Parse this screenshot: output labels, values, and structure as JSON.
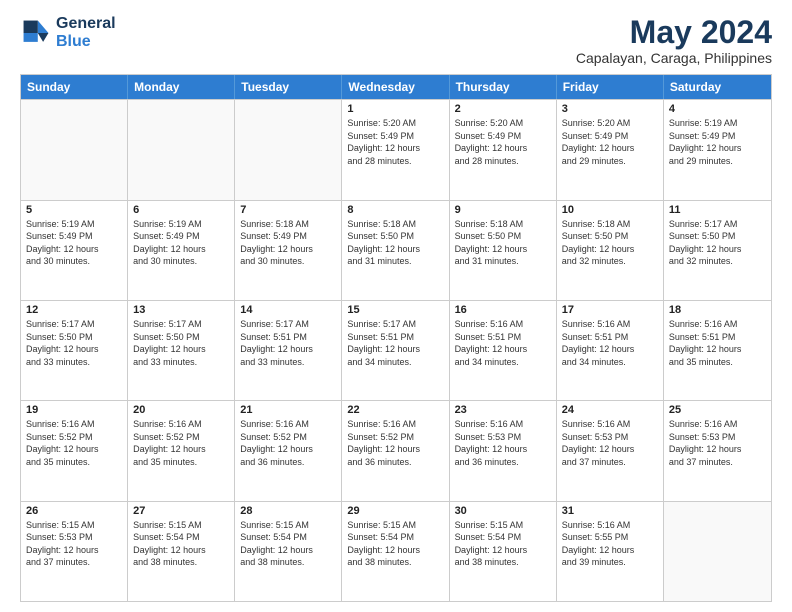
{
  "logo": {
    "line1": "General",
    "line2": "Blue"
  },
  "title": "May 2024",
  "subtitle": "Capalayan, Caraga, Philippines",
  "header_days": [
    "Sunday",
    "Monday",
    "Tuesday",
    "Wednesday",
    "Thursday",
    "Friday",
    "Saturday"
  ],
  "weeks": [
    [
      {
        "day": "",
        "info": "",
        "empty": true
      },
      {
        "day": "",
        "info": "",
        "empty": true
      },
      {
        "day": "",
        "info": "",
        "empty": true
      },
      {
        "day": "1",
        "info": "Sunrise: 5:20 AM\nSunset: 5:49 PM\nDaylight: 12 hours\nand 28 minutes."
      },
      {
        "day": "2",
        "info": "Sunrise: 5:20 AM\nSunset: 5:49 PM\nDaylight: 12 hours\nand 28 minutes."
      },
      {
        "day": "3",
        "info": "Sunrise: 5:20 AM\nSunset: 5:49 PM\nDaylight: 12 hours\nand 29 minutes."
      },
      {
        "day": "4",
        "info": "Sunrise: 5:19 AM\nSunset: 5:49 PM\nDaylight: 12 hours\nand 29 minutes."
      }
    ],
    [
      {
        "day": "5",
        "info": "Sunrise: 5:19 AM\nSunset: 5:49 PM\nDaylight: 12 hours\nand 30 minutes."
      },
      {
        "day": "6",
        "info": "Sunrise: 5:19 AM\nSunset: 5:49 PM\nDaylight: 12 hours\nand 30 minutes."
      },
      {
        "day": "7",
        "info": "Sunrise: 5:18 AM\nSunset: 5:49 PM\nDaylight: 12 hours\nand 30 minutes."
      },
      {
        "day": "8",
        "info": "Sunrise: 5:18 AM\nSunset: 5:50 PM\nDaylight: 12 hours\nand 31 minutes."
      },
      {
        "day": "9",
        "info": "Sunrise: 5:18 AM\nSunset: 5:50 PM\nDaylight: 12 hours\nand 31 minutes."
      },
      {
        "day": "10",
        "info": "Sunrise: 5:18 AM\nSunset: 5:50 PM\nDaylight: 12 hours\nand 32 minutes."
      },
      {
        "day": "11",
        "info": "Sunrise: 5:17 AM\nSunset: 5:50 PM\nDaylight: 12 hours\nand 32 minutes."
      }
    ],
    [
      {
        "day": "12",
        "info": "Sunrise: 5:17 AM\nSunset: 5:50 PM\nDaylight: 12 hours\nand 33 minutes."
      },
      {
        "day": "13",
        "info": "Sunrise: 5:17 AM\nSunset: 5:50 PM\nDaylight: 12 hours\nand 33 minutes."
      },
      {
        "day": "14",
        "info": "Sunrise: 5:17 AM\nSunset: 5:51 PM\nDaylight: 12 hours\nand 33 minutes."
      },
      {
        "day": "15",
        "info": "Sunrise: 5:17 AM\nSunset: 5:51 PM\nDaylight: 12 hours\nand 34 minutes."
      },
      {
        "day": "16",
        "info": "Sunrise: 5:16 AM\nSunset: 5:51 PM\nDaylight: 12 hours\nand 34 minutes."
      },
      {
        "day": "17",
        "info": "Sunrise: 5:16 AM\nSunset: 5:51 PM\nDaylight: 12 hours\nand 34 minutes."
      },
      {
        "day": "18",
        "info": "Sunrise: 5:16 AM\nSunset: 5:51 PM\nDaylight: 12 hours\nand 35 minutes."
      }
    ],
    [
      {
        "day": "19",
        "info": "Sunrise: 5:16 AM\nSunset: 5:52 PM\nDaylight: 12 hours\nand 35 minutes."
      },
      {
        "day": "20",
        "info": "Sunrise: 5:16 AM\nSunset: 5:52 PM\nDaylight: 12 hours\nand 35 minutes."
      },
      {
        "day": "21",
        "info": "Sunrise: 5:16 AM\nSunset: 5:52 PM\nDaylight: 12 hours\nand 36 minutes."
      },
      {
        "day": "22",
        "info": "Sunrise: 5:16 AM\nSunset: 5:52 PM\nDaylight: 12 hours\nand 36 minutes."
      },
      {
        "day": "23",
        "info": "Sunrise: 5:16 AM\nSunset: 5:53 PM\nDaylight: 12 hours\nand 36 minutes."
      },
      {
        "day": "24",
        "info": "Sunrise: 5:16 AM\nSunset: 5:53 PM\nDaylight: 12 hours\nand 37 minutes."
      },
      {
        "day": "25",
        "info": "Sunrise: 5:16 AM\nSunset: 5:53 PM\nDaylight: 12 hours\nand 37 minutes."
      }
    ],
    [
      {
        "day": "26",
        "info": "Sunrise: 5:15 AM\nSunset: 5:53 PM\nDaylight: 12 hours\nand 37 minutes."
      },
      {
        "day": "27",
        "info": "Sunrise: 5:15 AM\nSunset: 5:54 PM\nDaylight: 12 hours\nand 38 minutes."
      },
      {
        "day": "28",
        "info": "Sunrise: 5:15 AM\nSunset: 5:54 PM\nDaylight: 12 hours\nand 38 minutes."
      },
      {
        "day": "29",
        "info": "Sunrise: 5:15 AM\nSunset: 5:54 PM\nDaylight: 12 hours\nand 38 minutes."
      },
      {
        "day": "30",
        "info": "Sunrise: 5:15 AM\nSunset: 5:54 PM\nDaylight: 12 hours\nand 38 minutes."
      },
      {
        "day": "31",
        "info": "Sunrise: 5:16 AM\nSunset: 5:55 PM\nDaylight: 12 hours\nand 39 minutes."
      },
      {
        "day": "",
        "info": "",
        "empty": true
      }
    ]
  ]
}
